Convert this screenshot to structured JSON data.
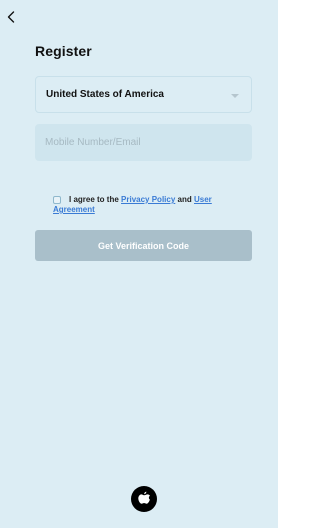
{
  "header": {
    "back_icon": "chevron-left-icon",
    "title": "Register"
  },
  "form": {
    "country": {
      "selected": "United States of America",
      "icon": "chevron-down-icon"
    },
    "account_input": {
      "value": "",
      "placeholder": "Mobile Number/Email"
    },
    "agreement": {
      "checked": false,
      "prefix": "I agree to the",
      "privacy_link": "Privacy Policy",
      "connector": "and",
      "user_agreement_link": "User Agreement"
    },
    "submit_label": "Get Verification Code"
  },
  "social": {
    "apple_icon": "apple-logo-icon"
  },
  "colors": {
    "background": "#dcedf4",
    "input_background": "#cfe5ee",
    "button_disabled": "#a9bfca",
    "link": "#3a7bd5"
  }
}
